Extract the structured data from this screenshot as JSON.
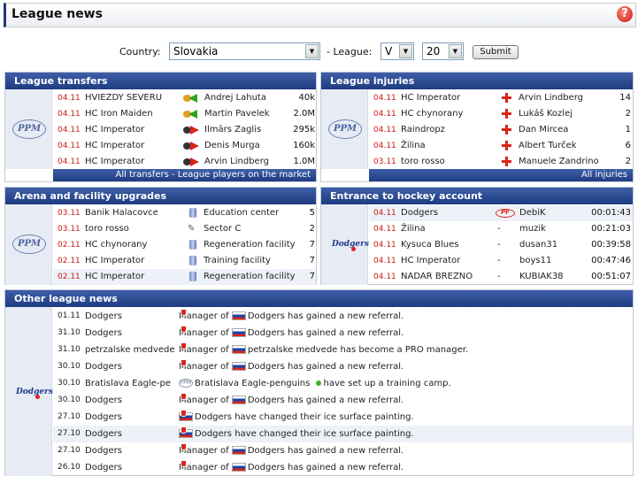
{
  "header": {
    "title": "League news",
    "help_icon": "help-icon"
  },
  "filters": {
    "country_label": "Country:",
    "country_value": "Slovakia",
    "league_label": "- League:",
    "league_value": "V",
    "league_number": "20",
    "submit_label": "Submit"
  },
  "transfers": {
    "title": "League transfers",
    "footer": "All transfers - League players on the market",
    "rows": [
      {
        "date": "04.11",
        "team": "HVIEZDY SEVERU",
        "direction": "in",
        "player": "Andrej Lahuta",
        "value": "40k"
      },
      {
        "date": "04.11",
        "team": "HC Iron Maiden",
        "direction": "in",
        "player": "Martin Pavelek",
        "value": "2.0M"
      },
      {
        "date": "04.11",
        "team": "HC Imperator",
        "direction": "out",
        "player": "Ilmārs Zaglis",
        "value": "295k"
      },
      {
        "date": "04.11",
        "team": "HC Imperator",
        "direction": "out",
        "player": "Denis Murga",
        "value": "160k"
      },
      {
        "date": "04.11",
        "team": "HC Imperator",
        "direction": "out",
        "player": "Arvin Lindberg",
        "value": "1.0M"
      }
    ]
  },
  "injuries": {
    "title": "League injuries",
    "footer": "All injuries",
    "rows": [
      {
        "date": "04.11",
        "team": "HC Imperator",
        "player": "Arvin Lindberg",
        "days": "14"
      },
      {
        "date": "04.11",
        "team": "HC chynorany",
        "player": "Lukáš Kozlej",
        "days": "2"
      },
      {
        "date": "04.11",
        "team": "Raindropz",
        "player": "Dan Mircea",
        "days": "1"
      },
      {
        "date": "04.11",
        "team": "Žilina",
        "player": "Albert Turček",
        "days": "6"
      },
      {
        "date": "03.11",
        "team": "toro rosso",
        "player": "Manuele Zandrino",
        "days": "2"
      }
    ]
  },
  "upgrades": {
    "title": "Arena and facility upgrades",
    "rows": [
      {
        "date": "03.11",
        "team": "Banik Halacovce",
        "icon": "facility-icon",
        "facility": "Education center",
        "level": "5"
      },
      {
        "date": "03.11",
        "team": "toro rosso",
        "icon": "sector-icon",
        "facility": "Sector C",
        "level": "2"
      },
      {
        "date": "02.11",
        "team": "HC chynorany",
        "icon": "facility-icon",
        "facility": "Regeneration facility",
        "level": "7"
      },
      {
        "date": "02.11",
        "team": "HC Imperator",
        "icon": "facility-icon",
        "facility": "Training facility",
        "level": "7"
      },
      {
        "date": "02.11",
        "team": "HC Imperator",
        "icon": "facility-icon",
        "facility": "Regeneration facility",
        "level": "7"
      }
    ]
  },
  "entrance": {
    "title": "Entrance to hockey account",
    "rows": [
      {
        "date": "04.11",
        "team": "Dodgers",
        "badge": "pf-icon",
        "user": "DebiK",
        "time": "00:01:43"
      },
      {
        "date": "04.11",
        "team": "Žilina",
        "badge": "-",
        "user": "muzik",
        "time": "00:21:03"
      },
      {
        "date": "04.11",
        "team": "Kysuca Blues",
        "badge": "-",
        "user": "dusan31",
        "time": "00:39:58"
      },
      {
        "date": "04.11",
        "team": "HC Imperator",
        "badge": "-",
        "user": "boys11",
        "time": "00:47:46"
      },
      {
        "date": "04.11",
        "team": "NADAR BREZNO",
        "badge": "-",
        "user": "KUBIAK38",
        "time": "00:51:07"
      }
    ]
  },
  "other": {
    "title": "Other league news",
    "rows": [
      {
        "date": "01.11",
        "team": "Dodgers",
        "pre": "Manager of",
        "subject": "Dodgers",
        "post": "has gained a new referral.",
        "icon": "flag-sk-icon"
      },
      {
        "date": "31.10",
        "team": "Dodgers",
        "pre": "Manager of",
        "subject": "Dodgers",
        "post": "has gained a new referral.",
        "icon": "flag-sk-icon"
      },
      {
        "date": "31.10",
        "team": "petrzalske medvede",
        "pre": "Manager of",
        "subject": "petrzalske medvede",
        "post": "has become a PRO manager.",
        "icon": "flag-sk-icon"
      },
      {
        "date": "30.10",
        "team": "Dodgers",
        "pre": "Manager of",
        "subject": "Dodgers",
        "post": "has gained a new referral.",
        "icon": "flag-sk-icon"
      },
      {
        "date": "30.10",
        "team": "Bratislava Eagle-pe",
        "pre": "",
        "subject": "Bratislava Eagle-penguins",
        "post": "have set up a training camp.",
        "icon": "ppm-icon"
      },
      {
        "date": "30.10",
        "team": "Dodgers",
        "pre": "Manager of",
        "subject": "Dodgers",
        "post": "has gained a new referral.",
        "icon": "flag-sk-icon"
      },
      {
        "date": "27.10",
        "team": "Dodgers",
        "pre": "",
        "subject": "Dodgers",
        "post": "have changed their ice surface painting.",
        "icon": "flag-sk-icon"
      },
      {
        "date": "27.10",
        "team": "Dodgers",
        "pre": "",
        "subject": "Dodgers",
        "post": "have changed their ice surface painting.",
        "icon": "flag-sk-icon"
      },
      {
        "date": "27.10",
        "team": "Dodgers",
        "pre": "Manager of",
        "subject": "Dodgers",
        "post": "has gained a new referral.",
        "icon": "flag-sk-icon"
      },
      {
        "date": "26.10",
        "team": "Dodgers",
        "pre": "Manager of",
        "subject": "Dodgers",
        "post": "has gained a new referral.",
        "icon": "flag-sk-icon"
      }
    ]
  },
  "logos": {
    "ppm": "PPM",
    "dodgers": "Dodgers"
  }
}
